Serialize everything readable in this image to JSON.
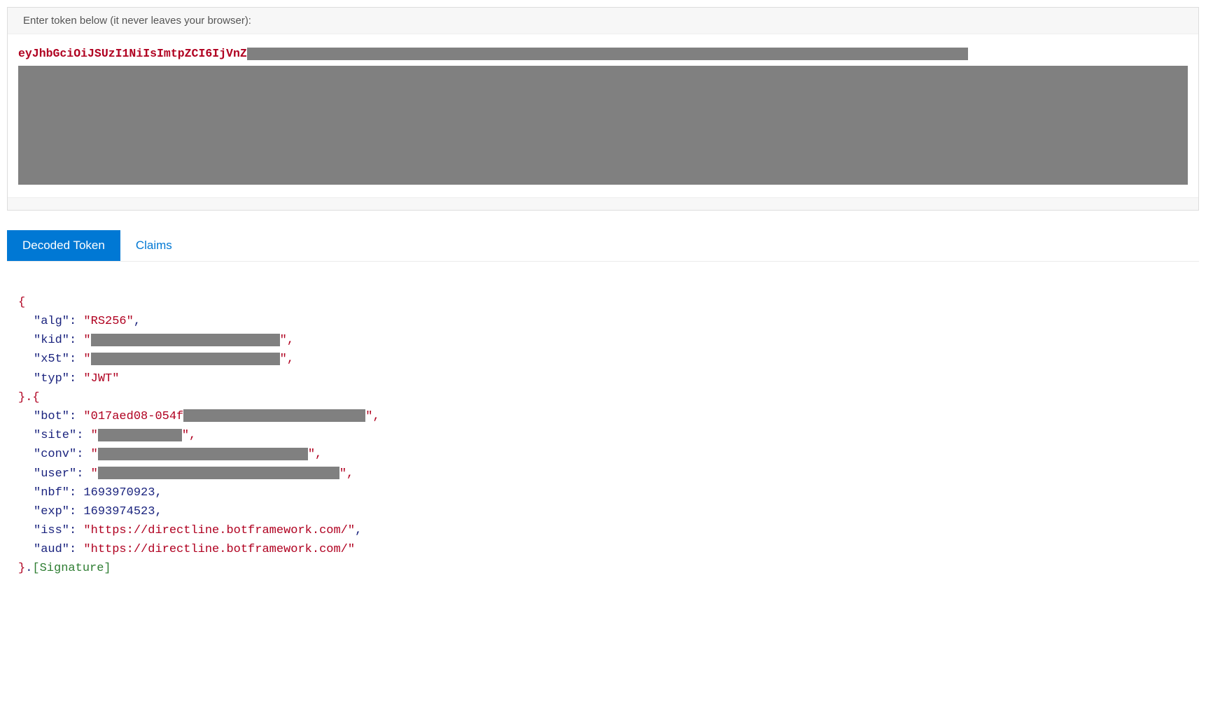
{
  "input": {
    "label": "Enter token below (it never leaves your browser):",
    "token_visible_prefix": "eyJhbGciOiJSUzI1NiIsImtpZCI6IjVnZ"
  },
  "tabs": {
    "decoded": "Decoded Token",
    "claims": "Claims"
  },
  "decoded": {
    "header": {
      "alg_key": "\"alg\"",
      "alg_val": "\"RS256\"",
      "kid_key": "\"kid\"",
      "x5t_key": "\"x5t\"",
      "typ_key": "\"typ\"",
      "typ_val": "\"JWT\""
    },
    "payload": {
      "bot_key": "\"bot\"",
      "bot_val_prefix": "\"017aed08-054f",
      "site_key": "\"site\"",
      "conv_key": "\"conv\"",
      "user_key": "\"user\"",
      "nbf_key": "\"nbf\"",
      "nbf_val": "1693970923",
      "exp_key": "\"exp\"",
      "exp_val": "1693974523",
      "iss_key": "\"iss\"",
      "iss_val": "\"https://directline.botframework.com/\"",
      "aud_key": "\"aud\"",
      "aud_val": "\"https://directline.botframework.com/\""
    },
    "signature": "[Signature]",
    "brace_open": "{",
    "brace_close_open": "}.{",
    "brace_close": "}",
    "colon": ": ",
    "comma": ",",
    "dot": ".",
    "quote": "\"",
    "quote_comma": "\","
  }
}
